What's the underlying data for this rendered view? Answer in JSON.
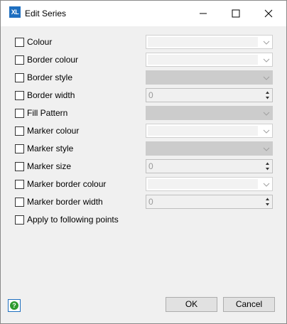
{
  "window": {
    "title": "Edit Series",
    "app_icon_text": "XL"
  },
  "rows": [
    {
      "label": "Colour",
      "control": "combo-white"
    },
    {
      "label": "Border colour",
      "control": "combo-white"
    },
    {
      "label": "Border style",
      "control": "combo-gray"
    },
    {
      "label": "Border width",
      "control": "spin",
      "value": "0"
    },
    {
      "label": "Fill Pattern",
      "control": "combo-gray"
    },
    {
      "label": "Marker colour",
      "control": "combo-white"
    },
    {
      "label": "Marker style",
      "control": "combo-gray"
    },
    {
      "label": "Marker size",
      "control": "spin",
      "value": "0"
    },
    {
      "label": "Marker border colour",
      "control": "combo-white"
    },
    {
      "label": "Marker border width",
      "control": "spin",
      "value": "0"
    },
    {
      "label": "Apply to following points",
      "control": "none"
    }
  ],
  "buttons": {
    "ok": "OK",
    "cancel": "Cancel",
    "help_glyph": "?"
  }
}
